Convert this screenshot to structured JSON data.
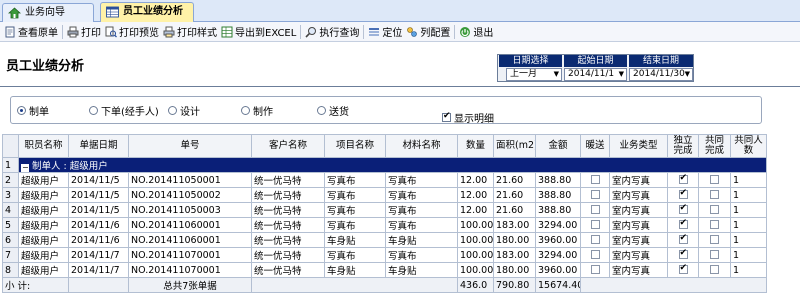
{
  "tabs": [
    {
      "label": "业务向导",
      "icon": "home-icon",
      "active": false
    },
    {
      "label": "员工业绩分析",
      "icon": "table-icon",
      "active": true
    }
  ],
  "toolbar": [
    {
      "label": "查看原单",
      "icon": "document-icon"
    },
    {
      "label": "打印",
      "icon": "printer-icon"
    },
    {
      "label": "打印预览",
      "icon": "print-preview-icon"
    },
    {
      "label": "打印样式",
      "icon": "print-style-icon"
    },
    {
      "label": "导出到EXCEL",
      "icon": "excel-export-icon"
    },
    {
      "label": "执行查询",
      "icon": "search-icon"
    },
    {
      "label": "定位",
      "icon": "locate-icon"
    },
    {
      "label": "列配置",
      "icon": "column-config-icon"
    },
    {
      "label": "退出",
      "icon": "exit-icon"
    }
  ],
  "page_title": "员工业绩分析",
  "date_filter": {
    "period_header": "日期选择",
    "start_header": "起始日期",
    "end_header": "结束日期",
    "period_value": "上一月",
    "start_value": "2014/11/1",
    "end_value": "2014/11/30"
  },
  "options": {
    "radios": [
      {
        "label": "制单",
        "checked": true
      },
      {
        "label": "下单(经手人)",
        "checked": false
      },
      {
        "label": "设计",
        "checked": false
      },
      {
        "label": "制作",
        "checked": false
      },
      {
        "label": "送货",
        "checked": false
      }
    ],
    "show_detail_label": "显示明细",
    "show_detail_checked": true
  },
  "grid": {
    "columns": [
      "职员名称",
      "单据日期",
      "单号",
      "客户名称",
      "项目名称",
      "材料名称",
      "数量",
      "面积(m2)",
      "金额",
      "暖送",
      "业务类型",
      "独立完成",
      "共同完成",
      "共同人数"
    ],
    "group_row": {
      "row_no": "1",
      "label": "制单人 : 超级用户"
    },
    "rows": [
      {
        "row_no": "2",
        "cells": [
          "超级用户",
          "2014/11/5",
          "NO.201411050001",
          "统一优马特",
          "写真布",
          "写真布",
          "12.00",
          "21.60",
          "388.80",
          "",
          "室内写真",
          "",
          "",
          "1"
        ],
        "indep": true,
        "joint": false,
        "deliver": false
      },
      {
        "row_no": "3",
        "cells": [
          "超级用户",
          "2014/11/5",
          "NO.201411050002",
          "统一优马特",
          "写真布",
          "写真布",
          "12.00",
          "21.60",
          "388.80",
          "",
          "室内写真",
          "",
          "",
          "1"
        ],
        "indep": true,
        "joint": false,
        "deliver": false
      },
      {
        "row_no": "4",
        "cells": [
          "超级用户",
          "2014/11/5",
          "NO.201411050003",
          "统一优马特",
          "写真布",
          "写真布",
          "12.00",
          "21.60",
          "388.80",
          "",
          "室内写真",
          "",
          "",
          "1"
        ],
        "indep": true,
        "joint": false,
        "deliver": false
      },
      {
        "row_no": "5",
        "cells": [
          "超级用户",
          "2014/11/6",
          "NO.201411060001",
          "统一优马特",
          "写真布",
          "写真布",
          "100.00",
          "183.00",
          "3294.00",
          "",
          "室内写真",
          "",
          "",
          "1"
        ],
        "indep": true,
        "joint": false,
        "deliver": false
      },
      {
        "row_no": "6",
        "cells": [
          "超级用户",
          "2014/11/6",
          "NO.201411060001",
          "统一优马特",
          "车身贴",
          "车身贴",
          "100.00",
          "180.00",
          "3960.00",
          "",
          "室内写真",
          "",
          "",
          "1"
        ],
        "indep": true,
        "joint": false,
        "deliver": false
      },
      {
        "row_no": "7",
        "cells": [
          "超级用户",
          "2014/11/7",
          "NO.201411070001",
          "统一优马特",
          "写真布",
          "写真布",
          "100.00",
          "183.00",
          "3294.00",
          "",
          "室内写真",
          "",
          "",
          "1"
        ],
        "indep": true,
        "joint": false,
        "deliver": false
      },
      {
        "row_no": "8",
        "cells": [
          "超级用户",
          "2014/11/7",
          "NO.201411070001",
          "统一优马特",
          "车身贴",
          "车身贴",
          "100.00",
          "180.00",
          "3960.00",
          "",
          "室内写真",
          "",
          "",
          "1"
        ],
        "indep": true,
        "joint": false,
        "deliver": false
      }
    ],
    "total_row": {
      "label": "小  计:",
      "summary": "总共7张单据",
      "qty": "436.0",
      "area": "790.80",
      "amount": "15674.40"
    }
  },
  "colors": {
    "header_navy": "#0a2a72",
    "group_navy": "#0a1f78",
    "tab_active": "#fff2a8"
  }
}
